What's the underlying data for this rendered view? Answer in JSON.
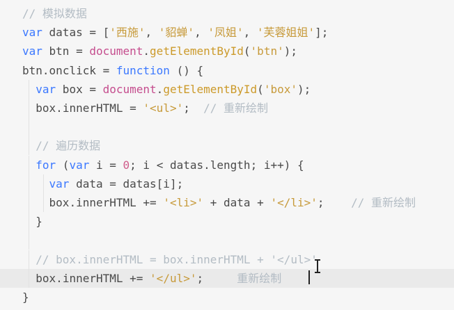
{
  "editor": {
    "lines": [
      [
        [
          "cmt",
          "// 模拟数据"
        ]
      ],
      [
        [
          "kw",
          "var"
        ],
        [
          "var",
          " datas "
        ],
        [
          "punc",
          "= ["
        ],
        [
          "str",
          "'西施'"
        ],
        [
          "punc",
          ", "
        ],
        [
          "str",
          "'貂蝉'"
        ],
        [
          "punc",
          ", "
        ],
        [
          "str",
          "'凤姐'"
        ],
        [
          "punc",
          ", "
        ],
        [
          "str",
          "'芙蓉姐姐'"
        ],
        [
          "punc",
          "];"
        ]
      ],
      [
        [
          "kw",
          "var"
        ],
        [
          "var",
          " btn "
        ],
        [
          "punc",
          "= "
        ],
        [
          "obj",
          "document"
        ],
        [
          "punc",
          "."
        ],
        [
          "fn",
          "getElementById"
        ],
        [
          "punc",
          "("
        ],
        [
          "str",
          "'btn'"
        ],
        [
          "punc",
          ");"
        ]
      ],
      [
        [
          "var",
          "btn"
        ],
        [
          "punc",
          "."
        ],
        [
          "var",
          "onclick "
        ],
        [
          "punc",
          "= "
        ],
        [
          "kw",
          "function"
        ],
        [
          "punc",
          " () {"
        ]
      ],
      [
        [
          "punc",
          "  "
        ],
        [
          "kw",
          "var"
        ],
        [
          "var",
          " box "
        ],
        [
          "punc",
          "= "
        ],
        [
          "obj",
          "document"
        ],
        [
          "punc",
          "."
        ],
        [
          "fn",
          "getElementById"
        ],
        [
          "punc",
          "("
        ],
        [
          "str",
          "'box'"
        ],
        [
          "punc",
          ");"
        ]
      ],
      [
        [
          "punc",
          "  "
        ],
        [
          "var",
          "box"
        ],
        [
          "punc",
          "."
        ],
        [
          "var",
          "innerHTML "
        ],
        [
          "punc",
          "= "
        ],
        [
          "str",
          "'<ul>'"
        ],
        [
          "punc",
          ";  "
        ],
        [
          "cmt",
          "// 重新绘制"
        ]
      ],
      [],
      [
        [
          "punc",
          "  "
        ],
        [
          "cmt",
          "// 遍历数据"
        ]
      ],
      [
        [
          "punc",
          "  "
        ],
        [
          "kw",
          "for"
        ],
        [
          "punc",
          " ("
        ],
        [
          "kw",
          "var"
        ],
        [
          "var",
          " i "
        ],
        [
          "punc",
          "= "
        ],
        [
          "num",
          "0"
        ],
        [
          "punc",
          "; "
        ],
        [
          "var",
          "i "
        ],
        [
          "punc",
          "< "
        ],
        [
          "var",
          "datas"
        ],
        [
          "punc",
          "."
        ],
        [
          "var",
          "length"
        ],
        [
          "punc",
          "; "
        ],
        [
          "var",
          "i"
        ],
        [
          "punc",
          "++) {"
        ]
      ],
      [
        [
          "punc",
          "    "
        ],
        [
          "kw",
          "var"
        ],
        [
          "var",
          " data "
        ],
        [
          "punc",
          "= "
        ],
        [
          "var",
          "datas"
        ],
        [
          "punc",
          "[i];"
        ]
      ],
      [
        [
          "punc",
          "    "
        ],
        [
          "var",
          "box"
        ],
        [
          "punc",
          "."
        ],
        [
          "var",
          "innerHTML "
        ],
        [
          "punc",
          "+= "
        ],
        [
          "str",
          "'<li>'"
        ],
        [
          "punc",
          " + "
        ],
        [
          "var",
          "data"
        ],
        [
          "punc",
          " + "
        ],
        [
          "str",
          "'</li>'"
        ],
        [
          "punc",
          ";    "
        ],
        [
          "cmt",
          "// 重新绘制"
        ]
      ],
      [
        [
          "punc",
          "  }"
        ]
      ],
      [],
      [
        [
          "punc",
          "  "
        ],
        [
          "cmt",
          "// box.innerHTML = box.innerHTML + '</ul>'"
        ]
      ],
      [
        [
          "punc",
          "  "
        ],
        [
          "var",
          "box"
        ],
        [
          "punc",
          "."
        ],
        [
          "var",
          "innerHTML "
        ],
        [
          "punc",
          "+= "
        ],
        [
          "str",
          "'</ul>'"
        ],
        [
          "punc",
          ";     "
        ],
        [
          "cmt",
          "重新绘制"
        ]
      ],
      [
        [
          "punc",
          "}"
        ]
      ]
    ]
  }
}
